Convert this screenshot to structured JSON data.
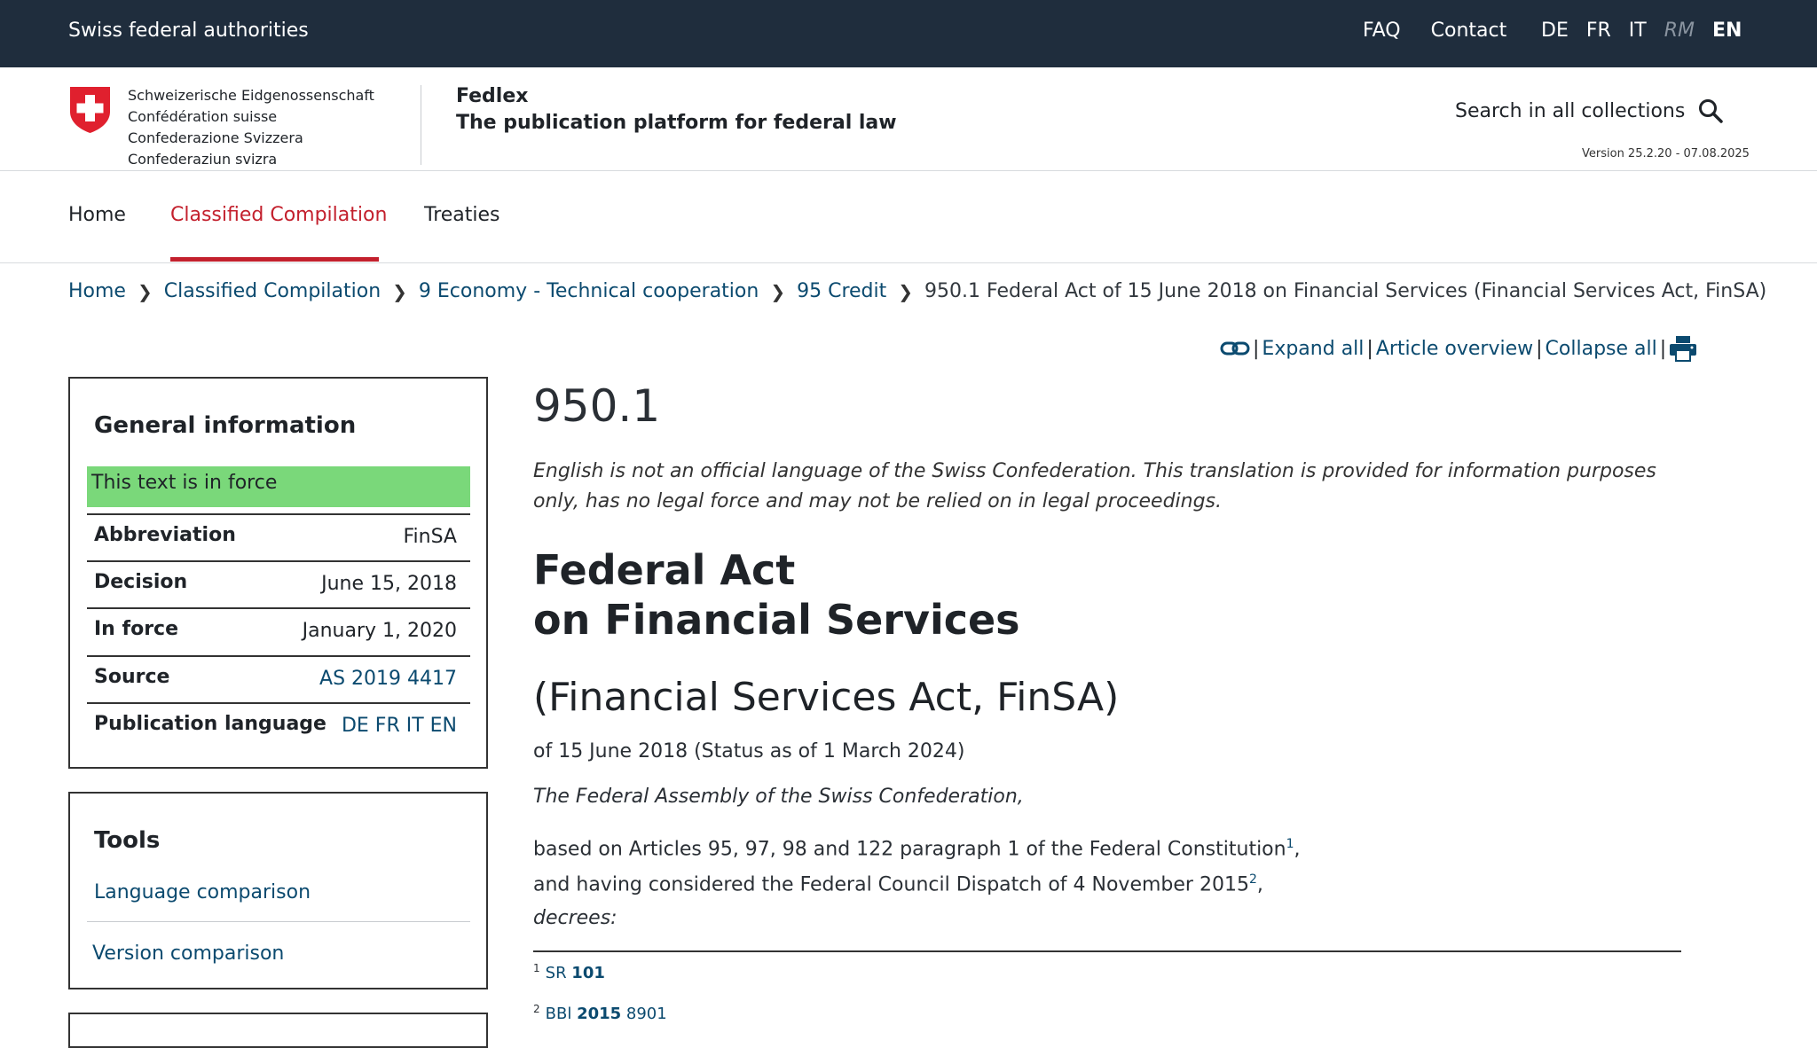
{
  "topbar": {
    "brand": "Swiss federal authorities",
    "faq": "FAQ",
    "contact": "Contact",
    "langs": [
      "DE",
      "FR",
      "IT",
      "RM",
      "EN"
    ]
  },
  "header": {
    "confed": [
      "Schweizerische Eidgenossenschaft",
      "Confédération suisse",
      "Confederazione Svizzera",
      "Confederaziun svizra"
    ],
    "app_title": "Fedlex",
    "app_subtitle": "The publication platform for federal law",
    "search_label": "Search in all collections",
    "version": "Version 25.2.20 - 07.08.2025"
  },
  "nav": {
    "home": "Home",
    "classified": "Classified Compilation",
    "treaties": "Treaties"
  },
  "breadcrumb": {
    "items": [
      "Home",
      "Classified Compilation",
      "9 Economy - Technical cooperation",
      "95 Credit"
    ],
    "current": "950.1 Federal Act of 15 June 2018 on Financial Services (Financial Services Act, FinSA)"
  },
  "toolbar": {
    "expand": "Expand all",
    "overview": "Article overview",
    "collapse": "Collapse all"
  },
  "general": {
    "heading": "General information",
    "status": "This text is in force",
    "rows": [
      {
        "key": "Abbreviation",
        "value": "FinSA"
      },
      {
        "key": "Decision",
        "value": "June 15, 2018"
      },
      {
        "key": "In force",
        "value": "January 1, 2020"
      },
      {
        "key": "Source",
        "value": "AS 2019 4417"
      },
      {
        "key": "Publication language",
        "value": "DE FR IT EN"
      }
    ]
  },
  "tools": {
    "heading": "Tools",
    "language_comparison": "Language comparison",
    "version_comparison": "Version comparison"
  },
  "doc": {
    "sr_number": "950.1",
    "note": "English is not an official language of the Swiss Confederation. This translation is provided for information purposes only, has no legal force and may not be relied on in legal proceedings.",
    "title_line1": "Federal Act",
    "title_line2": "on Financial Services",
    "short_title": "(Financial Services Act, FinSA)",
    "date": "of 15 June 2018 (Status as of 1 March 2024)",
    "assembly": "The Federal Assembly of the Swiss Confederation,",
    "basis_line1": "based on Articles 95, 97, 98 and 122 paragraph 1 of the Federal Constitution",
    "basis_line2": "and having considered the Federal Council Dispatch of 4 November 2015",
    "fn_ref1": "1",
    "fn_ref2": "2",
    "decrees": "decrees:",
    "footnotes": [
      {
        "num": "1",
        "prefix": "SR ",
        "bold": "101",
        "suffix": ""
      },
      {
        "num": "2",
        "prefix": "BBl ",
        "bold": "2015",
        "suffix": " 8901"
      }
    ]
  },
  "colors": {
    "topbar_bg": "#1f2d3d",
    "accent_red": "#c3202d",
    "link_blue": "#0b4a6f",
    "status_green": "#7ad87a"
  }
}
